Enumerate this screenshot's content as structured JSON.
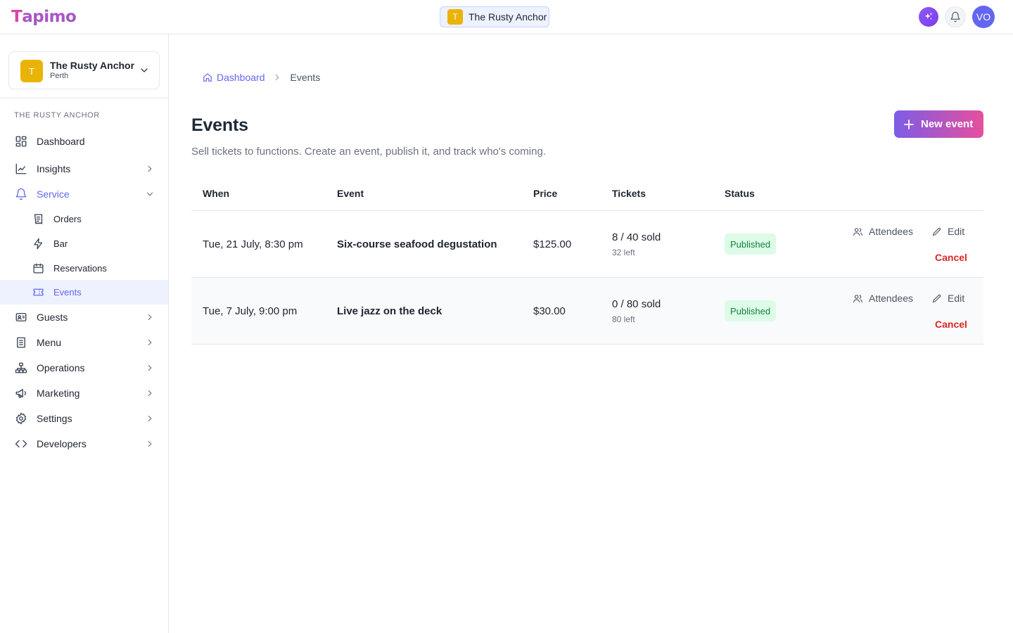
{
  "brand": {
    "logo_text": "apimo",
    "logo_initial": "T"
  },
  "header": {
    "venue_initial": "T",
    "venue_name": "The Rusty Anchor",
    "avatar_initials": "VO"
  },
  "sidebar": {
    "venue": {
      "initial": "T",
      "name": "The Rusty Anchor",
      "city": "Perth"
    },
    "section_label": "THE RUSTY ANCHOR",
    "items": [
      {
        "label": "Dashboard",
        "icon": "dashboard-icon"
      },
      {
        "label": "Insights",
        "icon": "chart-line-icon"
      },
      {
        "label": "Service",
        "icon": "bell-icon"
      },
      {
        "label": "Guests",
        "icon": "id-card-icon"
      },
      {
        "label": "Menu",
        "icon": "menu-book-icon"
      },
      {
        "label": "Operations",
        "icon": "org-chart-icon"
      },
      {
        "label": "Marketing",
        "icon": "megaphone-icon"
      },
      {
        "label": "Settings",
        "icon": "gear-icon"
      },
      {
        "label": "Developers",
        "icon": "code-icon"
      }
    ],
    "sub_items": [
      {
        "label": "Orders",
        "icon": "receipt-icon"
      },
      {
        "label": "Bar",
        "icon": "lightning-icon"
      },
      {
        "label": "Reservations",
        "icon": "calendar-icon"
      },
      {
        "label": "Events",
        "icon": "ticket-icon"
      }
    ]
  },
  "breadcrumb": {
    "home": "Dashboard",
    "current": "Events"
  },
  "page": {
    "title": "Events",
    "subtitle": "Sell tickets to functions. Create an event, publish it, and track who's coming.",
    "new_button": "New event"
  },
  "table": {
    "headers": {
      "when": "When",
      "event": "Event",
      "price": "Price",
      "tickets": "Tickets",
      "status": "Status"
    },
    "rows": [
      {
        "when": "Tue, 21 July, 8:30 pm",
        "event": "Six-course seafood degustation",
        "price": "$125.00",
        "tickets": "8 / 40 sold",
        "left": "32 left",
        "status": "Published",
        "actions": {
          "attendees": "Attendees",
          "edit": "Edit",
          "cancel": "Cancel"
        }
      },
      {
        "when": "Tue, 7 July, 9:00 pm",
        "event": "Live jazz on the deck",
        "price": "$30.00",
        "tickets": "0 / 80 sold",
        "left": "80 left",
        "status": "Published",
        "actions": {
          "attendees": "Attendees",
          "edit": "Edit",
          "cancel": "Cancel"
        }
      }
    ]
  },
  "colors": {
    "accent": "#6366f1",
    "venue": "#eab308",
    "published_bg": "#dcfce7",
    "published_text": "#15803d",
    "danger": "#dc2626"
  }
}
